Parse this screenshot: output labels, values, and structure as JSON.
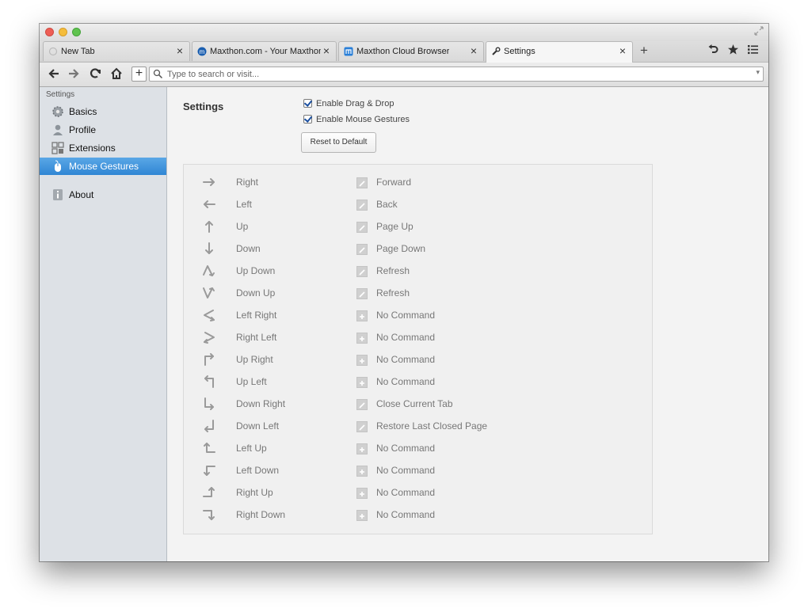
{
  "colors": {
    "accent": "#3a8bd7",
    "sidebar_bg": "#dde1e6",
    "muted_text": "#777777"
  },
  "tabs": [
    {
      "label": "New Tab",
      "icon": "spinner-icon",
      "active": false
    },
    {
      "label": "Maxthon.com - Your Maxthon",
      "icon": "maxthon-logo-icon",
      "active": false
    },
    {
      "label": "Maxthon Cloud Browser",
      "icon": "maxthon-cloud-icon",
      "active": false
    },
    {
      "label": "Settings",
      "icon": "wrench-icon",
      "active": true
    }
  ],
  "toolbar": {
    "new_tab_symbol": "+",
    "tab_close_symbol": "×",
    "undo_icon": "undo-icon",
    "favorites_icon": "star-icon",
    "menu_icon": "menu-icon"
  },
  "navbar": {
    "back": "back-icon",
    "forward": "forward-icon",
    "refresh": "refresh-icon",
    "home": "home-icon",
    "add_symbol": "+",
    "search_placeholder": "Type to search or visit..."
  },
  "sidebar": {
    "heading": "Settings",
    "items": [
      {
        "label": "Basics",
        "icon": "gear-icon",
        "selected": false
      },
      {
        "label": "Profile",
        "icon": "user-icon",
        "selected": false
      },
      {
        "label": "Extensions",
        "icon": "extensions-icon",
        "selected": false
      },
      {
        "label": "Mouse Gestures",
        "icon": "mouse-icon",
        "selected": true
      },
      {
        "label": "About",
        "icon": "info-icon",
        "selected": false
      }
    ]
  },
  "main": {
    "title": "Settings",
    "options": [
      {
        "label": "Enable Drag & Drop",
        "checked": true
      },
      {
        "label": "Enable Mouse Gestures",
        "checked": true
      }
    ],
    "reset_label": "Reset to Default",
    "gestures": [
      {
        "gesture": "Right",
        "command": "Forward",
        "assigned": true
      },
      {
        "gesture": "Left",
        "command": "Back",
        "assigned": true
      },
      {
        "gesture": "Up",
        "command": "Page Up",
        "assigned": true
      },
      {
        "gesture": "Down",
        "command": "Page Down",
        "assigned": true
      },
      {
        "gesture": "Up Down",
        "command": "Refresh",
        "assigned": true
      },
      {
        "gesture": "Down Up",
        "command": "Refresh",
        "assigned": true
      },
      {
        "gesture": "Left Right",
        "command": "No Command",
        "assigned": false
      },
      {
        "gesture": "Right Left",
        "command": "No Command",
        "assigned": false
      },
      {
        "gesture": "Up Right",
        "command": "No Command",
        "assigned": false
      },
      {
        "gesture": "Up Left",
        "command": "No Command",
        "assigned": false
      },
      {
        "gesture": "Down Right",
        "command": "Close Current Tab",
        "assigned": true
      },
      {
        "gesture": "Down Left",
        "command": "Restore Last Closed Page",
        "assigned": true
      },
      {
        "gesture": "Left Up",
        "command": "No Command",
        "assigned": false
      },
      {
        "gesture": "Left Down",
        "command": "No Command",
        "assigned": false
      },
      {
        "gesture": "Right Up",
        "command": "No Command",
        "assigned": false
      },
      {
        "gesture": "Right Down",
        "command": "No Command",
        "assigned": false
      }
    ]
  }
}
